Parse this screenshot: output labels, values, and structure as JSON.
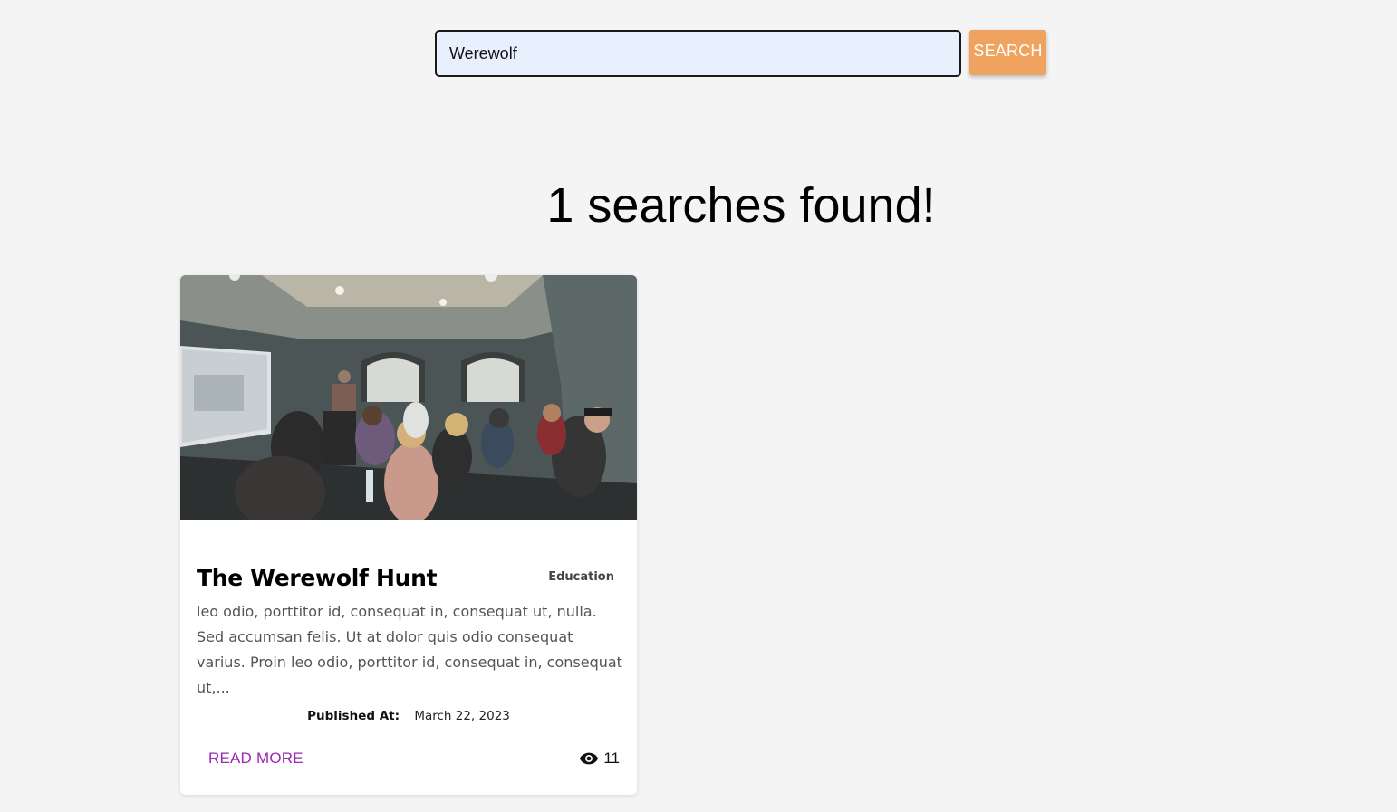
{
  "search": {
    "value": "Werewolf",
    "button_label": "SEARCH"
  },
  "results": {
    "heading": "1 searches found!"
  },
  "card": {
    "title": "The Werewolf Hunt",
    "category": "Education",
    "excerpt": "leo odio, porttitor id, consequat in, consequat ut, nulla. Sed accumsan felis. Ut at dolor quis odio consequat varius. Proin leo odio, porttitor id, consequat in, consequat ut,...",
    "published_label": "Published At:",
    "published_date": "March 22, 2023",
    "read_more_label": "READ MORE",
    "views": "11",
    "view_icon": "eye-icon"
  },
  "colors": {
    "background": "#f4f4f4",
    "search_button": "#f0a35e",
    "input_fill": "#e8f0fe",
    "read_more": "#9c27b0"
  }
}
